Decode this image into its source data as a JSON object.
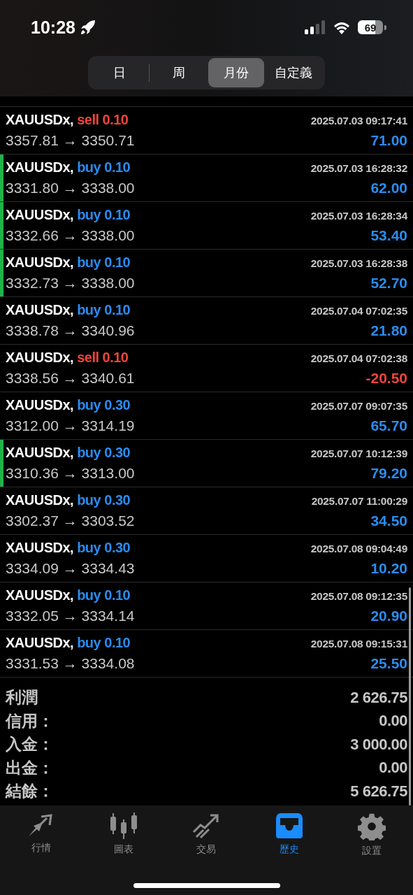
{
  "status_bar": {
    "time": "10:28",
    "battery": "69"
  },
  "period_tabs": [
    {
      "label": "日",
      "selected": false
    },
    {
      "label": "周",
      "selected": false
    },
    {
      "label": "月份",
      "selected": true
    },
    {
      "label": "自定義",
      "selected": false
    }
  ],
  "deals": [
    {
      "symbol": "XAUUSDx,",
      "side": "sell 0.10",
      "kind": "sell",
      "marked": false,
      "time": "2025.07.03 09:17:41",
      "prices": "3357.81 → 3350.71",
      "profit": "71.00",
      "loss": false
    },
    {
      "symbol": "XAUUSDx,",
      "side": "buy 0.10",
      "kind": "buy",
      "marked": true,
      "time": "2025.07.03 16:28:32",
      "prices": "3331.80 → 3338.00",
      "profit": "62.00",
      "loss": false
    },
    {
      "symbol": "XAUUSDx,",
      "side": "buy 0.10",
      "kind": "buy",
      "marked": true,
      "time": "2025.07.03 16:28:34",
      "prices": "3332.66 → 3338.00",
      "profit": "53.40",
      "loss": false
    },
    {
      "symbol": "XAUUSDx,",
      "side": "buy 0.10",
      "kind": "buy",
      "marked": true,
      "time": "2025.07.03 16:28:38",
      "prices": "3332.73 → 3338.00",
      "profit": "52.70",
      "loss": false
    },
    {
      "symbol": "XAUUSDx,",
      "side": "buy 0.10",
      "kind": "buy",
      "marked": false,
      "time": "2025.07.04 07:02:35",
      "prices": "3338.78 → 3340.96",
      "profit": "21.80",
      "loss": false
    },
    {
      "symbol": "XAUUSDx,",
      "side": "sell 0.10",
      "kind": "sell",
      "marked": false,
      "time": "2025.07.04 07:02:38",
      "prices": "3338.56 → 3340.61",
      "profit": "-20.50",
      "loss": true
    },
    {
      "symbol": "XAUUSDx,",
      "side": "buy 0.30",
      "kind": "buy",
      "marked": false,
      "time": "2025.07.07 09:07:35",
      "prices": "3312.00 → 3314.19",
      "profit": "65.70",
      "loss": false
    },
    {
      "symbol": "XAUUSDx,",
      "side": "buy 0.30",
      "kind": "buy",
      "marked": true,
      "time": "2025.07.07 10:12:39",
      "prices": "3310.36 → 3313.00",
      "profit": "79.20",
      "loss": false
    },
    {
      "symbol": "XAUUSDx,",
      "side": "buy 0.30",
      "kind": "buy",
      "marked": false,
      "time": "2025.07.07 11:00:29",
      "prices": "3302.37 → 3303.52",
      "profit": "34.50",
      "loss": false
    },
    {
      "symbol": "XAUUSDx,",
      "side": "buy 0.30",
      "kind": "buy",
      "marked": false,
      "time": "2025.07.08 09:04:49",
      "prices": "3334.09 → 3334.43",
      "profit": "10.20",
      "loss": false
    },
    {
      "symbol": "XAUUSDx,",
      "side": "buy 0.10",
      "kind": "buy",
      "marked": false,
      "time": "2025.07.08 09:12:35",
      "prices": "3332.05 → 3334.14",
      "profit": "20.90",
      "loss": false
    },
    {
      "symbol": "XAUUSDx,",
      "side": "buy 0.10",
      "kind": "buy",
      "marked": false,
      "time": "2025.07.08 09:15:31",
      "prices": "3331.53 → 3334.08",
      "profit": "25.50",
      "loss": false
    }
  ],
  "summary": [
    {
      "label": "利潤",
      "value": "2 626.75"
    },
    {
      "label": "信用：",
      "value": "0.00"
    },
    {
      "label": "入金：",
      "value": "3 000.00"
    },
    {
      "label": "出金：",
      "value": "0.00"
    },
    {
      "label": "結餘：",
      "value": "5 626.75"
    }
  ],
  "tab_bar": [
    {
      "label": "行情",
      "kind": "quotes",
      "selected": false
    },
    {
      "label": "圖表",
      "kind": "chart",
      "selected": false
    },
    {
      "label": "交易",
      "kind": "trade",
      "selected": false
    },
    {
      "label": "歷史",
      "kind": "history",
      "selected": true
    },
    {
      "label": "設置",
      "kind": "settings",
      "selected": false
    }
  ]
}
